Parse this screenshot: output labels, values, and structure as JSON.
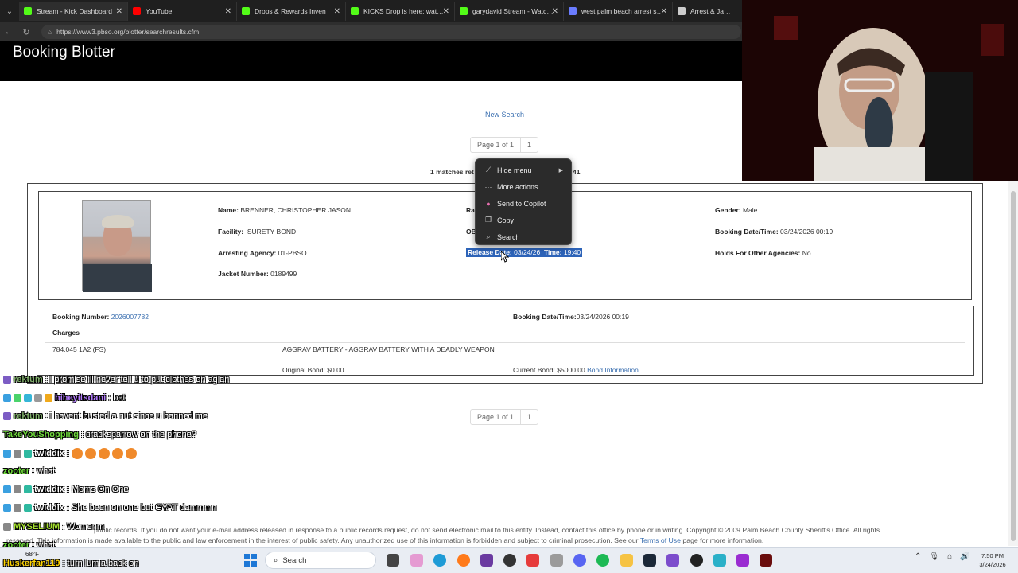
{
  "browser": {
    "tabs": [
      {
        "label": "Stream - Kick Dashboard",
        "color": "#53fc18"
      },
      {
        "label": "YouTube",
        "color": "#ff0000"
      },
      {
        "label": "Drops & Rewards Inven",
        "color": "#53fc18"
      },
      {
        "label": "KICKS Drop is here: watch, e",
        "color": "#53fc18"
      },
      {
        "label": "garydavid Stream - Watch Li",
        "color": "#53fc18"
      },
      {
        "label": "west palm beach arrest sear",
        "color": "#6a7cff"
      },
      {
        "label": "Arrest & Jail - F",
        "color": "#cccccc"
      }
    ],
    "url": "https://www3.pbso.org/blotter/searchresults.cfm"
  },
  "page": {
    "title": "Booking Blotter",
    "new_search": "New Search",
    "pager_top": {
      "page": "Page 1 of 1",
      "num": "1"
    },
    "pager_bottom": {
      "page": "Page 1 of 1",
      "num": "1"
    },
    "matches_text": "1 matches ret",
    "matches_tail": "41",
    "record": {
      "name_label": "Name:",
      "name": "BRENNER, CHRISTOPHER JASON",
      "facility_label": "Facility:",
      "facility": "SURETY BOND",
      "agency_label": "Arresting Agency:",
      "agency": "01-PBSO",
      "jacket_label": "Jacket Number:",
      "jacket": "0189499",
      "race_label": "Ra",
      "obts_label": "OB",
      "release_label": "Release Date:",
      "release": "03/24/26",
      "time_label": "Time:",
      "time": "19:40",
      "gender_label": "Gender:",
      "gender": "Male",
      "booking_dt_label": "Booking Date/Time:",
      "booking_dt": "03/24/2026 00:19",
      "holds_label": "Holds For Other Agencies:",
      "holds": "No"
    },
    "booking": {
      "number_label": "Booking Number:",
      "number": "2026007782",
      "dt_label": "Booking Date/Time:",
      "dt": "03/24/2026 00:19",
      "charges_label": "Charges",
      "statute": "784.045 1A2 (FS)",
      "charge_desc": "AGGRAV BATTERY - AGGRAV BATTERY WITH A DEADLY WEAPON",
      "orig_bond_label": "Original Bond:",
      "orig_bond": "$0.00",
      "curr_bond_label": "Current Bond:",
      "curr_bond": "$5000.00",
      "bond_info": "Bond Information"
    },
    "footer_line1": "public records. If you do not want your e-mail address released in response to a public records request, do not send electronic mail to this entity. Instead, contact this office by phone or in writing. Copyright © 2009 Palm Beach County Sheriff's Office. All rights",
    "footer_line2": "reserved. This information is made available to the public and law enforcement in the interest of public safety. Any unauthorized use of this information is forbidden and subject to criminal prosecution. See our",
    "footer_link": "Terms of Use",
    "footer_tail": "page for more information."
  },
  "context_menu": {
    "items": [
      {
        "label": "Hide menu",
        "icon": "hide-icon",
        "submenu": true
      },
      {
        "label": "More actions",
        "icon": "more-icon"
      },
      {
        "label": "Send to Copilot",
        "icon": "copilot-icon"
      },
      {
        "label": "Copy",
        "icon": "copy-icon"
      },
      {
        "label": "Search",
        "icon": "search-icon"
      }
    ]
  },
  "chat": [
    {
      "user": "rektum",
      "text": ": i promise ill never tell u to put clothes on agian",
      "color": "#7fae6a"
    },
    {
      "user": "hiheyitsdani",
      "text": ": bet",
      "color": "#b57cff"
    },
    {
      "user": "rektum",
      "text": ": i havent busted a nut since u banned me",
      "color": "#7fae6a"
    },
    {
      "user": "TakeYouShopping",
      "text": ": cracksparrow on the phone?",
      "color": "#6fdc3b"
    },
    {
      "user": "twiddix",
      "text": ":",
      "color": "#ffffff",
      "emotes": 5
    },
    {
      "user": "zooter",
      "text": ": what",
      "color": "#6fdc3b"
    },
    {
      "user": "twiddix",
      "text": ": Moms On One",
      "color": "#ffffff"
    },
    {
      "user": "twiddix",
      "text": ": She been on one but GYAT dammmn",
      "color": "#ffffff"
    },
    {
      "user": "MYSELIUM",
      "text": ": Womenm",
      "color": "#a6e22e"
    },
    {
      "user": "zooter",
      "text": ": what",
      "color": "#6fdc3b"
    },
    {
      "user": "Huskerfan119",
      "text": ": turn lumia back on",
      "color": "#ffd400"
    }
  ],
  "taskbar": {
    "weather": "68°F",
    "search": "Search",
    "time": "7:50 PM",
    "date": "3/24/2026"
  }
}
